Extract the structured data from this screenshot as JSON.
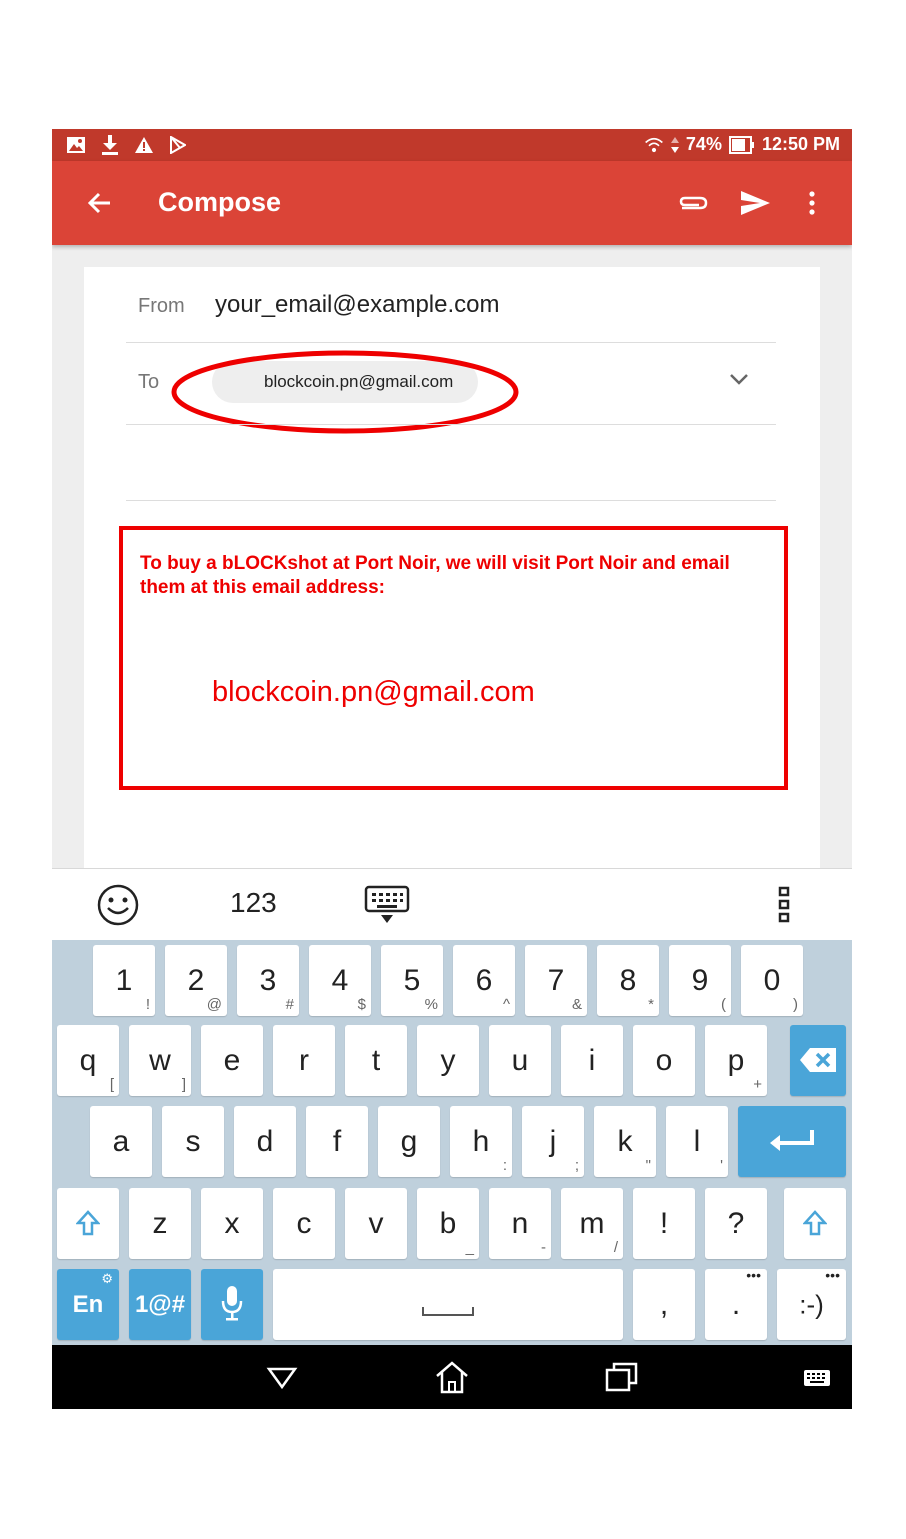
{
  "status_bar": {
    "battery": "74%",
    "time": "12:50 PM",
    "icons": [
      "image-icon",
      "download-icon",
      "warning-icon",
      "play-store-icon",
      "wifi-icon",
      "signal-arrows-icon",
      "battery-icon"
    ]
  },
  "app_bar": {
    "title": "Compose",
    "actions": [
      "back-arrow-icon",
      "paperclip-icon",
      "send-icon",
      "more-vert-icon"
    ]
  },
  "compose": {
    "from_label": "From",
    "from_value": "your_email@example.com",
    "to_label": "To",
    "to_chip": "blockcoin.pn@gmail.com"
  },
  "annotation": {
    "text": "To buy a bLOCKshot at Port Noir, we will visit Port Noir and email them at this email address:",
    "email": "blockcoin.pn@gmail.com",
    "color": "#ee0000"
  },
  "keyboard_toolbar": {
    "numbers_label": "123"
  },
  "keyboard": {
    "row1": [
      {
        "k": "1",
        "s": "!"
      },
      {
        "k": "2",
        "s": "@"
      },
      {
        "k": "3",
        "s": "#"
      },
      {
        "k": "4",
        "s": "$"
      },
      {
        "k": "5",
        "s": "%"
      },
      {
        "k": "6",
        "s": "^"
      },
      {
        "k": "7",
        "s": "&"
      },
      {
        "k": "8",
        "s": "*"
      },
      {
        "k": "9",
        "s": "("
      },
      {
        "k": "0",
        "s": ")"
      }
    ],
    "row2": [
      {
        "k": "q",
        "s": "["
      },
      {
        "k": "w",
        "s": "]"
      },
      {
        "k": "e",
        "s": ""
      },
      {
        "k": "r",
        "s": ""
      },
      {
        "k": "t",
        "s": ""
      },
      {
        "k": "y",
        "s": ""
      },
      {
        "k": "u",
        "s": ""
      },
      {
        "k": "i",
        "s": ""
      },
      {
        "k": "o",
        "s": ""
      },
      {
        "k": "p",
        "s": "+"
      }
    ],
    "row3": [
      {
        "k": "a",
        "s": ""
      },
      {
        "k": "s",
        "s": ""
      },
      {
        "k": "d",
        "s": ""
      },
      {
        "k": "f",
        "s": ""
      },
      {
        "k": "g",
        "s": ""
      },
      {
        "k": "h",
        "s": ":"
      },
      {
        "k": "j",
        "s": ";"
      },
      {
        "k": "k",
        "s": "\""
      },
      {
        "k": "l",
        "s": "'"
      }
    ],
    "row4": [
      {
        "k": "z",
        "s": ""
      },
      {
        "k": "x",
        "s": ""
      },
      {
        "k": "c",
        "s": ""
      },
      {
        "k": "v",
        "s": ""
      },
      {
        "k": "b",
        "s": "_"
      },
      {
        "k": "n",
        "s": "-"
      },
      {
        "k": "m",
        "s": "/"
      },
      {
        "k": "!",
        "s": ""
      },
      {
        "k": "?",
        "s": ""
      }
    ],
    "lang_label": "En",
    "symbols_label": "1@#",
    "comma": ",",
    "period": ".",
    "smiley": ":-)",
    "accent": "#4aa5d8"
  }
}
